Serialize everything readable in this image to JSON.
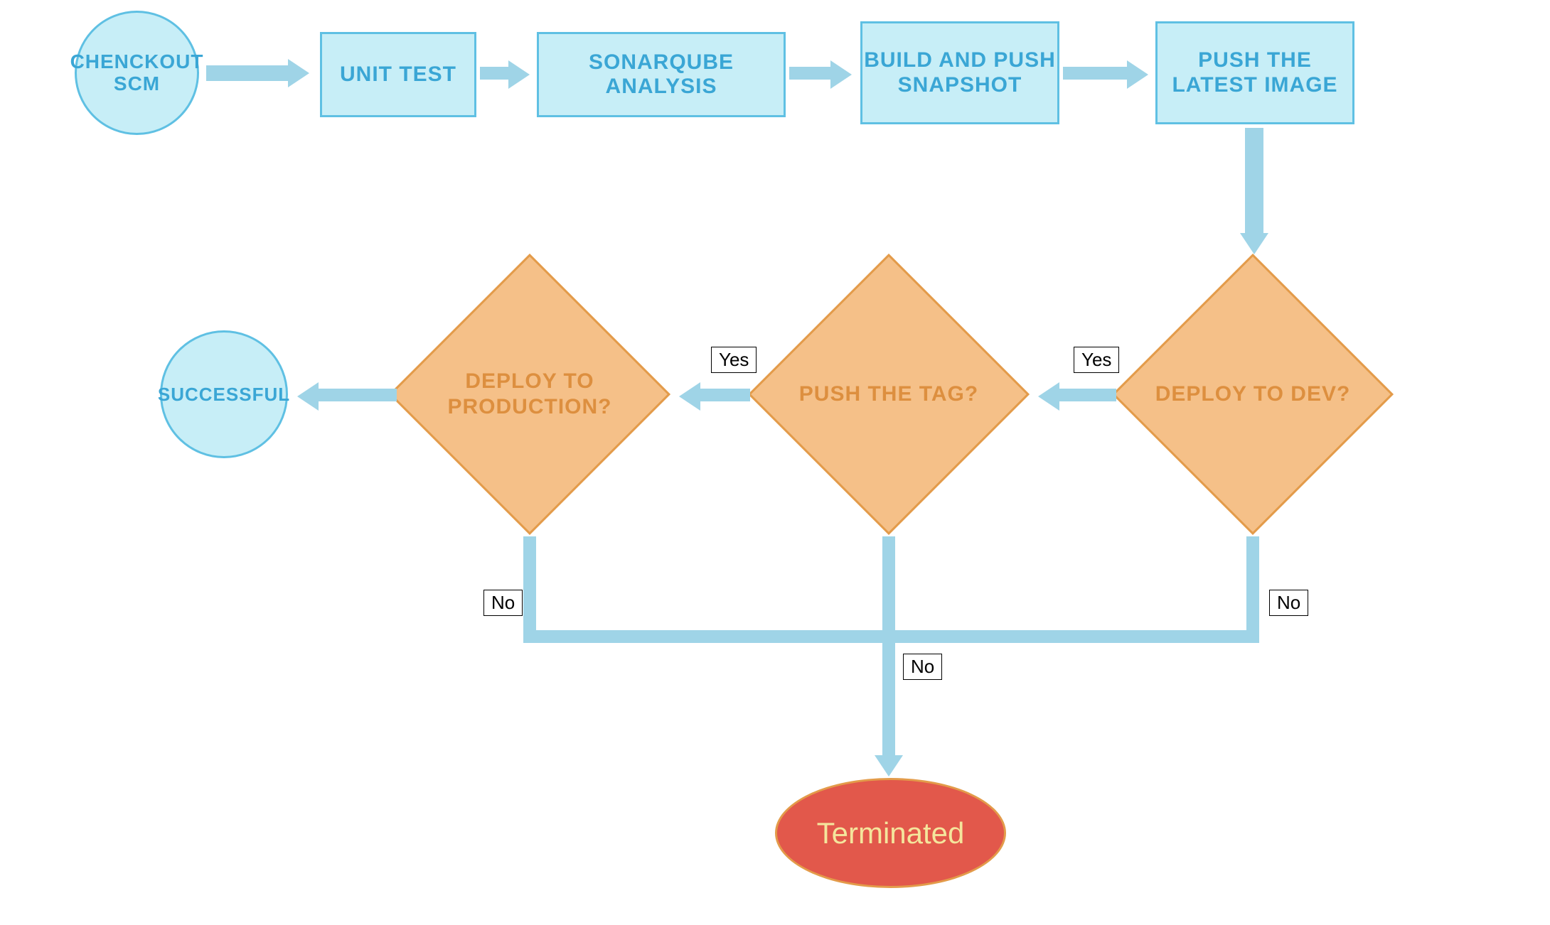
{
  "nodes": {
    "checkout_scm": "CHENCKOUT SCM",
    "unit_test": "UNIT TEST",
    "sonarqube": "SONARQUBE ANALYSIS",
    "build_push_snapshot": "BUILD AND PUSH SNAPSHOT",
    "push_latest_image": "PUSH THE LATEST IMAGE",
    "deploy_dev": "DEPLOY TO DEV?",
    "push_tag": "PUSH THE TAG?",
    "deploy_prod": "DEPLOY TO PRODUCTION?",
    "successful": "SUCCESSFUL",
    "terminated": "Terminated"
  },
  "labels": {
    "yes1": "Yes",
    "yes2": "Yes",
    "no1": "No",
    "no2": "No",
    "no3": "No"
  }
}
